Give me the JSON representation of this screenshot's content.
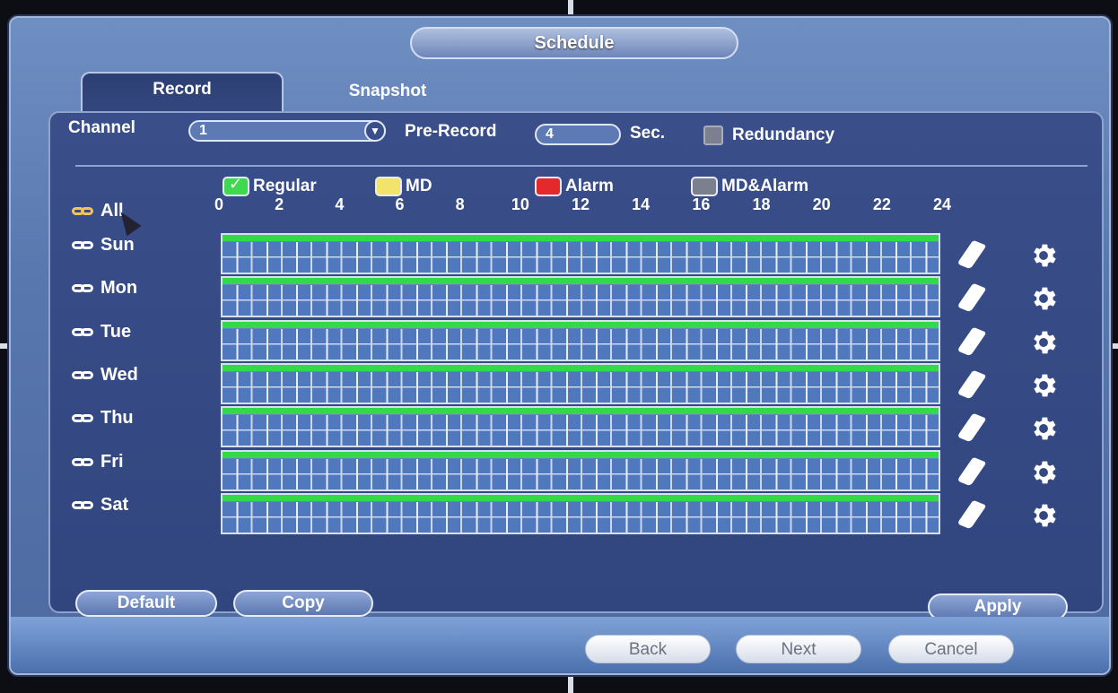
{
  "window": {
    "title": "Schedule"
  },
  "tabs": [
    {
      "label": "Record",
      "active": true
    },
    {
      "label": "Snapshot",
      "active": false
    }
  ],
  "settings": {
    "channel_label": "Channel",
    "channel_value": "1",
    "prerecord_label": "Pre-Record",
    "prerecord_value": "4",
    "prerecord_unit": "Sec.",
    "redundancy_label": "Redundancy",
    "redundancy_checked": false
  },
  "legend": [
    {
      "label": "Regular",
      "color": "#3fd94f",
      "checked": true
    },
    {
      "label": "MD",
      "color": "#f2e46a"
    },
    {
      "label": "Alarm",
      "color": "#e3292a"
    },
    {
      "label": "MD&Alarm",
      "color": "#7b7f8e"
    }
  ],
  "hours": [
    "0",
    "2",
    "4",
    "6",
    "8",
    "10",
    "12",
    "14",
    "16",
    "18",
    "20",
    "22",
    "24"
  ],
  "all_label": "All",
  "days": [
    {
      "label": "Sun",
      "regular_coverage": 1.0
    },
    {
      "label": "Mon",
      "regular_coverage": 1.0
    },
    {
      "label": "Tue",
      "regular_coverage": 1.0
    },
    {
      "label": "Wed",
      "regular_coverage": 1.0
    },
    {
      "label": "Thu",
      "regular_coverage": 1.0
    },
    {
      "label": "Fri",
      "regular_coverage": 1.0
    },
    {
      "label": "Sat",
      "regular_coverage": 1.0
    }
  ],
  "buttons": {
    "default": "Default",
    "copy": "Copy",
    "apply": "Apply"
  },
  "footer": {
    "back": "Back",
    "next": "Next",
    "cancel": "Cancel"
  },
  "colors": {
    "regular": "#34d94a",
    "panel": "#34487f",
    "accent": "#5d7ab5"
  }
}
